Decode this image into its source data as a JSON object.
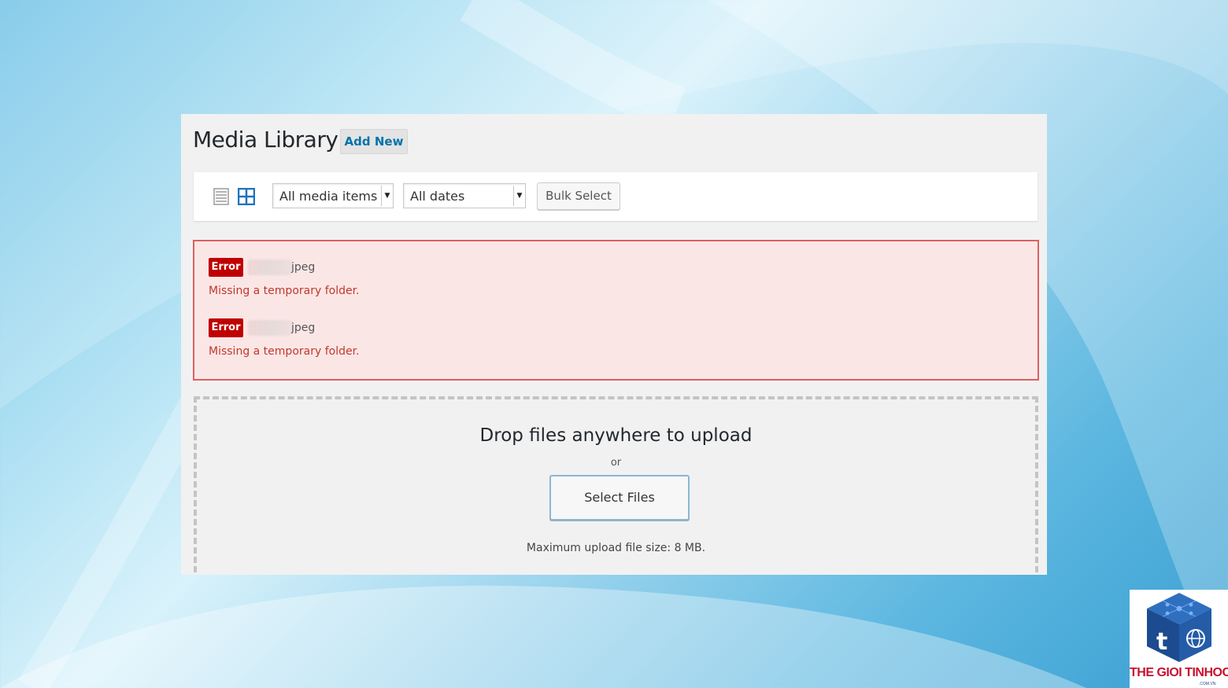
{
  "page": {
    "title": "Media Library",
    "add_new": "Add New"
  },
  "toolbar": {
    "filter_type": "All media items",
    "filter_date": "All dates",
    "bulk_select": "Bulk Select",
    "icons": [
      "list-view-icon",
      "grid-view-icon"
    ]
  },
  "errors": [
    {
      "badge": "Error",
      "file_ext": "jpeg",
      "message": "Missing a temporary folder."
    },
    {
      "badge": "Error",
      "file_ext": "jpeg",
      "message": "Missing a temporary folder."
    }
  ],
  "upload": {
    "heading": "Drop files anywhere to upload",
    "or": "or",
    "select_files": "Select Files",
    "max_size": "Maximum upload file size: 8 MB."
  },
  "watermark": {
    "text": "THE GIOI TINHOC",
    "sub": ".COM.VN"
  },
  "colors": {
    "link": "#0073aa",
    "error_badge": "#c00000",
    "error_bg": "#fbe6e6",
    "error_border": "#dc6060",
    "logo_red": "#c8102e",
    "logo_blue": "#1c4b8f"
  }
}
